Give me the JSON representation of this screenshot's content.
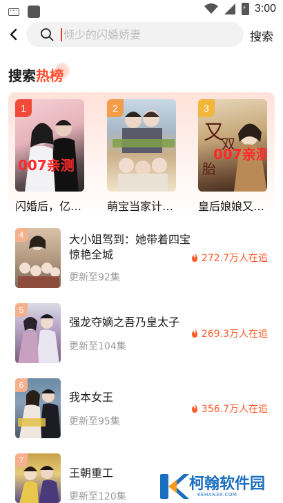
{
  "status_bar": {
    "time": "3:00"
  },
  "search": {
    "placeholder": "倾少的闪婚娇妻",
    "submit_label": "搜索"
  },
  "section": {
    "title_part1": "搜索",
    "title_part2": "热榜"
  },
  "top3": [
    {
      "rank": "1",
      "title": "闪婚后，亿…",
      "badge_color": "#f24a3a"
    },
    {
      "rank": "2",
      "title": "萌宝当家计…",
      "badge_color": "#f39c4a"
    },
    {
      "rank": "3",
      "title": "皇后娘娘又…",
      "badge_color": "#f2b73a"
    }
  ],
  "poster_overlay_text": "007亲测",
  "list": [
    {
      "rank": "4",
      "title": "大小姐驾到：她带着四宝惊艳全城",
      "sub": "更新至92集",
      "heat": "272.7万人在追"
    },
    {
      "rank": "5",
      "title": "强龙夺嫡之吾乃皇太子",
      "sub": "更新至104集",
      "heat": "269.3万人在追"
    },
    {
      "rank": "6",
      "title": "我本女王",
      "sub": "更新至95集",
      "heat": "356.7万人在追"
    },
    {
      "rank": "7",
      "title": "王朝重工",
      "sub": "更新至120集",
      "heat": ""
    }
  ],
  "logo": {
    "name": "柯翰软件园",
    "url_text": "KEHAN38.COM"
  },
  "colors": {
    "accent": "#ff4d2d",
    "heat": "#ff5a2a",
    "brand": "#1b6fbf"
  },
  "icons": {
    "back": "chevron-left-icon",
    "search": "search-icon",
    "heat": "fire-icon"
  }
}
